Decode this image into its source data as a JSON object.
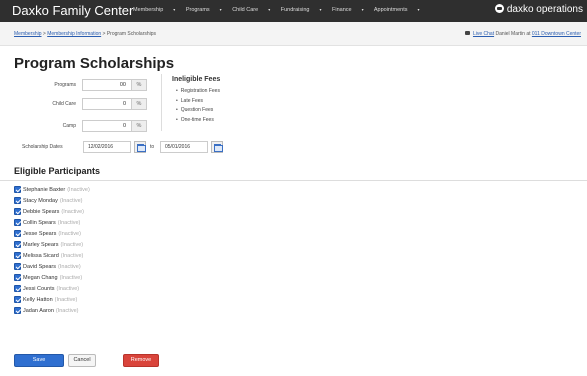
{
  "app": {
    "title": "Daxko Family Center",
    "logo_text": "daxko operations"
  },
  "nav": {
    "items": [
      "Membership",
      "Programs",
      "Child Care",
      "Fundraising",
      "Finance",
      "Appointments"
    ]
  },
  "breadcrumb": {
    "items": [
      "Membership",
      "Membership Information",
      "Program Scholarships"
    ],
    "separator": ">"
  },
  "user": {
    "live_chat": "Live Chat",
    "signed_in_as": "Daniel Martin at",
    "location": "011 Downtown Center"
  },
  "page": {
    "title": "Program Scholarships"
  },
  "form": {
    "fields": [
      {
        "label": "Programs",
        "value": "00",
        "unit": "%"
      },
      {
        "label": "Child Care",
        "value": "0",
        "unit": "%"
      },
      {
        "label": "Camp",
        "value": "0",
        "unit": "%"
      }
    ],
    "dates": {
      "label": "Scholarship Dates",
      "start": "12/02/2016",
      "to_label": "to",
      "end": "05/01/2016"
    }
  },
  "ineligible": {
    "title": "Ineligible Fees",
    "items": [
      "Registration Fees",
      "Late Fees",
      "Question Fees",
      "One-time Fees"
    ]
  },
  "eligible": {
    "title": "Eligible Participants",
    "participants": [
      {
        "name": "Stephanie Baxter",
        "status": "(Inactive)",
        "checked": true
      },
      {
        "name": "Stacy Monday",
        "status": "(Inactive)",
        "checked": true
      },
      {
        "name": "Debbie Spears",
        "status": "(Inactive)",
        "checked": true
      },
      {
        "name": "Collin Spears",
        "status": "(Inactive)",
        "checked": true
      },
      {
        "name": "Jesse Spears",
        "status": "(Inactive)",
        "checked": true
      },
      {
        "name": "Marley Spears",
        "status": "(Inactive)",
        "checked": true
      },
      {
        "name": "Melissa Sicard",
        "status": "(Inactive)",
        "checked": true
      },
      {
        "name": "David Spears",
        "status": "(Inactive)",
        "checked": true
      },
      {
        "name": "Megan Chang",
        "status": "(Inactive)",
        "checked": true
      },
      {
        "name": "Jessi Counts",
        "status": "(Inactive)",
        "checked": true
      },
      {
        "name": "Kelly Hatton",
        "status": "(Inactive)",
        "checked": true
      },
      {
        "name": "Jadan Aaron",
        "status": "(Inactive)",
        "checked": true
      }
    ]
  },
  "actions": {
    "save": "Save",
    "cancel": "Cancel",
    "remove": "Remove"
  },
  "colors": {
    "topbar": "#2f2f2f",
    "primary": "#2f6fd0",
    "danger": "#d9443b",
    "link": "#2a5db0"
  }
}
